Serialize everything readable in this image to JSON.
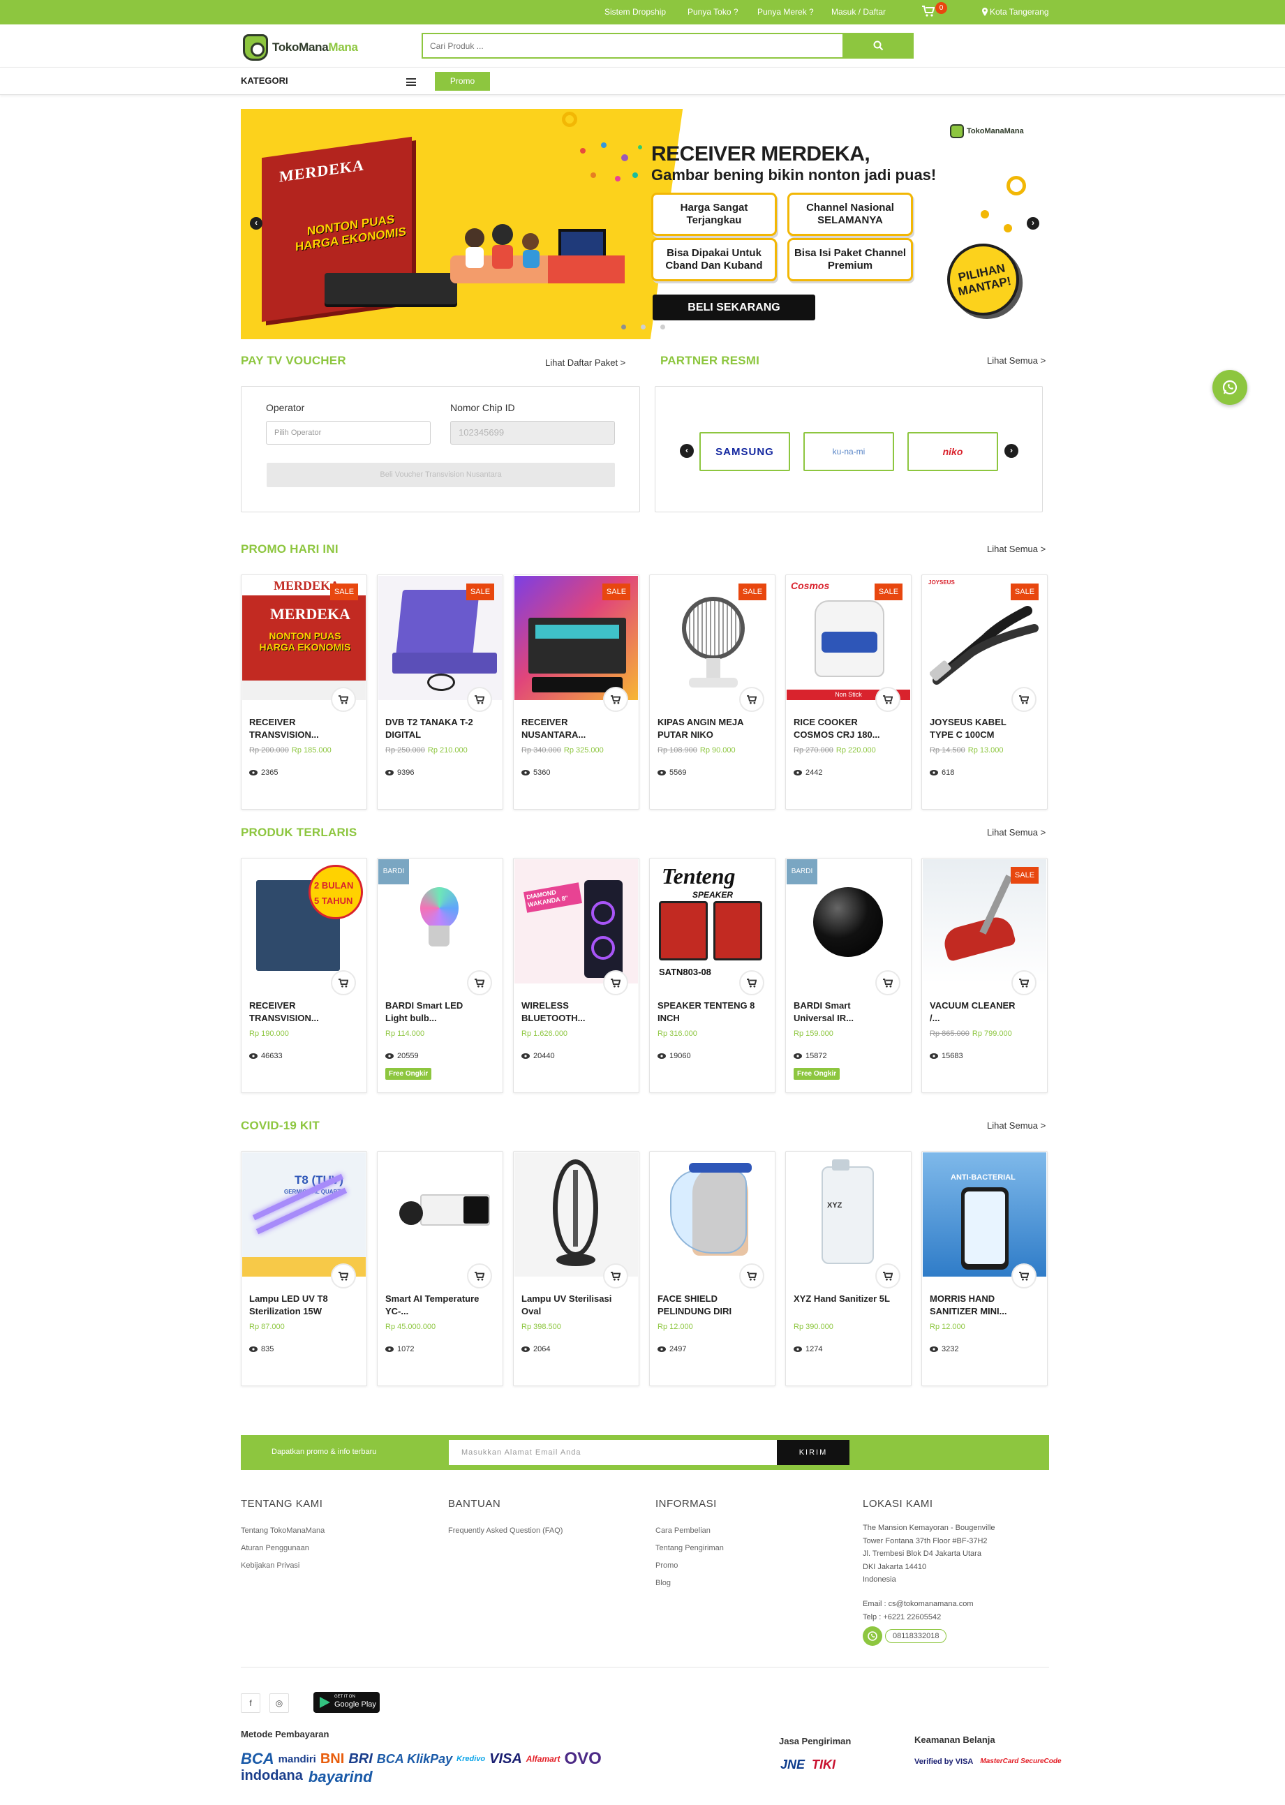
{
  "topbar": {
    "links": [
      "Sistem Dropship",
      "Punya Toko ?",
      "Punya Merek ?",
      "Masuk / Daftar"
    ],
    "cart_count": "0",
    "location": "Kota Tangerang"
  },
  "header": {
    "logo_text_1": "TokoMana",
    "logo_text_2": "Mana",
    "search_placeholder": "Cari Produk ...",
    "kategori_label": "KATEGORI",
    "promo_label": "Promo"
  },
  "banner": {
    "title": "RECEIVER MERDEKA,",
    "subtitle": "Gambar bening bikin nonton jadi puas!",
    "features": [
      "Harga Sangat Terjangkau",
      "Channel Nasional SELAMANYA",
      "Bisa Dipakai Untuk Cband Dan Kuband",
      "Bisa Isi Paket Channel Premium"
    ],
    "cta": "BELI SEKARANG",
    "badge": "PILIHAN MANTAP!",
    "box_brand": "MERDEKA",
    "box_slogan": "NONTON PUAS HARGA EKONOMIS",
    "logo_text": "TokoManaMana"
  },
  "paytv": {
    "title": "PAY TV VOUCHER",
    "link": "Lihat Daftar Paket >",
    "operator_label": "Operator",
    "operator_placeholder": "Pilih Operator",
    "chip_label": "Nomor Chip ID",
    "chip_placeholder": "102345699",
    "button": "Beli Voucher Transvision Nusantara"
  },
  "partner": {
    "title": "PARTNER RESMI",
    "link": "Lihat Semua >",
    "logos": [
      "SAMSUNG",
      "ku-na-mi",
      "niko"
    ]
  },
  "sections": {
    "promo": {
      "title": "PROMO HARI INI",
      "link": "Lihat Semua >",
      "items": [
        {
          "name": "RECEIVER TRANSVISION...",
          "old": "Rp 200.000",
          "price": "Rp 185.000",
          "views": "2365",
          "sale": "SALE"
        },
        {
          "name": "DVB T2 TANAKA T-2 DIGITAL",
          "old": "Rp 250.000",
          "price": "Rp 210.000",
          "views": "9396",
          "sale": "SALE"
        },
        {
          "name": "RECEIVER NUSANTARA...",
          "old": "Rp 340.000",
          "price": "Rp 325.000",
          "views": "5360",
          "sale": "SALE"
        },
        {
          "name": "KIPAS ANGIN MEJA PUTAR NIKO",
          "old": "Rp 108.900",
          "price": "Rp 90.000",
          "views": "5569",
          "sale": "SALE"
        },
        {
          "name": "RICE COOKER COSMOS CRJ 180...",
          "old": "Rp 270.000",
          "price": "Rp 220.000",
          "views": "2442",
          "sale": "SALE"
        },
        {
          "name": "JOYSEUS KABEL TYPE C 100CM",
          "old": "Rp 14.500",
          "price": "Rp 13.000",
          "views": "618",
          "sale": "SALE"
        }
      ]
    },
    "terlaris": {
      "title": "PRODUK TERLARIS",
      "link": "Lihat Semua >",
      "items": [
        {
          "name": "RECEIVER TRANSVISION...",
          "old": "",
          "price": "Rp 190.000",
          "views": "46633",
          "free": ""
        },
        {
          "name": "BARDI Smart LED Light bulb...",
          "old": "",
          "price": "Rp 114.000",
          "views": "20559",
          "free": "Free Ongkir"
        },
        {
          "name": "WIRELESS BLUETOOTH...",
          "old": "",
          "price": "Rp 1.626.000",
          "views": "20440",
          "free": ""
        },
        {
          "name": "SPEAKER TENTENG 8 INCH",
          "old": "",
          "price": "Rp 316.000",
          "views": "19060",
          "free": ""
        },
        {
          "name": "BARDI Smart Universal IR...",
          "old": "",
          "price": "Rp 159.000",
          "views": "15872",
          "free": "Free Ongkir"
        },
        {
          "name": "VACUUM CLEANER /...",
          "old": "Rp 865.000",
          "price": "Rp 799.000",
          "views": "15683",
          "free": "",
          "sale": "SALE"
        }
      ]
    },
    "covid": {
      "title": "COVID-19 KIT",
      "link": "Lihat Semua >",
      "items": [
        {
          "name": "Lampu LED UV T8 Sterilization 15W",
          "price": "Rp 87.000",
          "views": "835"
        },
        {
          "name": "Smart AI Temperature YC-...",
          "price": "Rp 45.000.000",
          "views": "1072"
        },
        {
          "name": "Lampu UV Sterilisasi Oval",
          "price": "Rp 398.500",
          "views": "2064"
        },
        {
          "name": "FACE SHIELD PELINDUNG DIRI",
          "price": "Rp 12.000",
          "views": "2497"
        },
        {
          "name": "XYZ Hand Sanitizer 5L",
          "price": "Rp 390.000",
          "views": "1274"
        },
        {
          "name": "MORRIS HAND SANITIZER MINI...",
          "price": "Rp 12.000",
          "views": "3232"
        }
      ]
    }
  },
  "image_text": {
    "merdeka": "MERDEKA",
    "merdeka_sub": "NONTON PUAS HARGA EKONOMIS",
    "bardi": "BARDI",
    "bonus": "2 BULAN",
    "bonus2": "5 TAHUN",
    "wakanda": "DIAMOND WAKANDA 8\"",
    "tenteng": "Tenteng",
    "tenteng2": "SPEAKER",
    "tenteng3": "SATN803-08",
    "t8": "T8 (TUV)",
    "t8sub": "GERMICIDAL QUARTZ",
    "morris": "ANTI-BACTERIAL",
    "cosmos": "Cosmos",
    "joyseus": "JOYSEUS",
    "xyz": "XYZ",
    "nonstick": "Non Stick"
  },
  "newsletter": {
    "text": "Dapatkan promo & info terbaru",
    "placeholder": "Masukkan Alamat Email Anda",
    "button": "KIRIM"
  },
  "footer": {
    "tentang": {
      "title": "TENTANG KAMI",
      "links": [
        "Tentang TokoManaMana",
        "Aturan Penggunaan",
        "Kebijakan Privasi"
      ]
    },
    "bantuan": {
      "title": "BANTUAN",
      "links": [
        "Frequently Asked Question (FAQ)"
      ]
    },
    "informasi": {
      "title": "INFORMASI",
      "links": [
        "Cara Pembelian",
        "Tentang Pengiriman",
        "Promo",
        "Blog"
      ]
    },
    "lokasi": {
      "title": "LOKASI KAMI",
      "address": [
        "The Mansion Kemayoran - Bougenville",
        "Tower Fontana 37th Floor #BF-37H2",
        "Jl. Trembesi Blok D4 Jakarta Utara",
        "DKI Jakarta 14410",
        "Indonesia"
      ],
      "email": "Email : cs@tokomanamana.com",
      "telp": "Telp : +6221 22605542",
      "whatsapp": "08118332018"
    },
    "gplay_small": "GET IT ON",
    "gplay_big": "Google Play",
    "metode_title": "Metode Pembayaran",
    "payments": [
      "BCA",
      "mandiri",
      "BNI",
      "BRI",
      "BCA KlikPay",
      "Kredivo",
      "VISA",
      "Alfamart",
      "OVO",
      "indodana",
      "bayarind"
    ],
    "jasa_title": "Jasa Pengiriman",
    "couriers": [
      "JNE",
      "TIKI"
    ],
    "keamanan_title": "Keamanan Belanja",
    "security": [
      "Verified by VISA",
      "MasterCard SecureCode"
    ]
  },
  "colors": {
    "brand_green": "#8dc63f",
    "sale_orange": "#e8470f",
    "banner_yellow": "#fcd21c"
  }
}
